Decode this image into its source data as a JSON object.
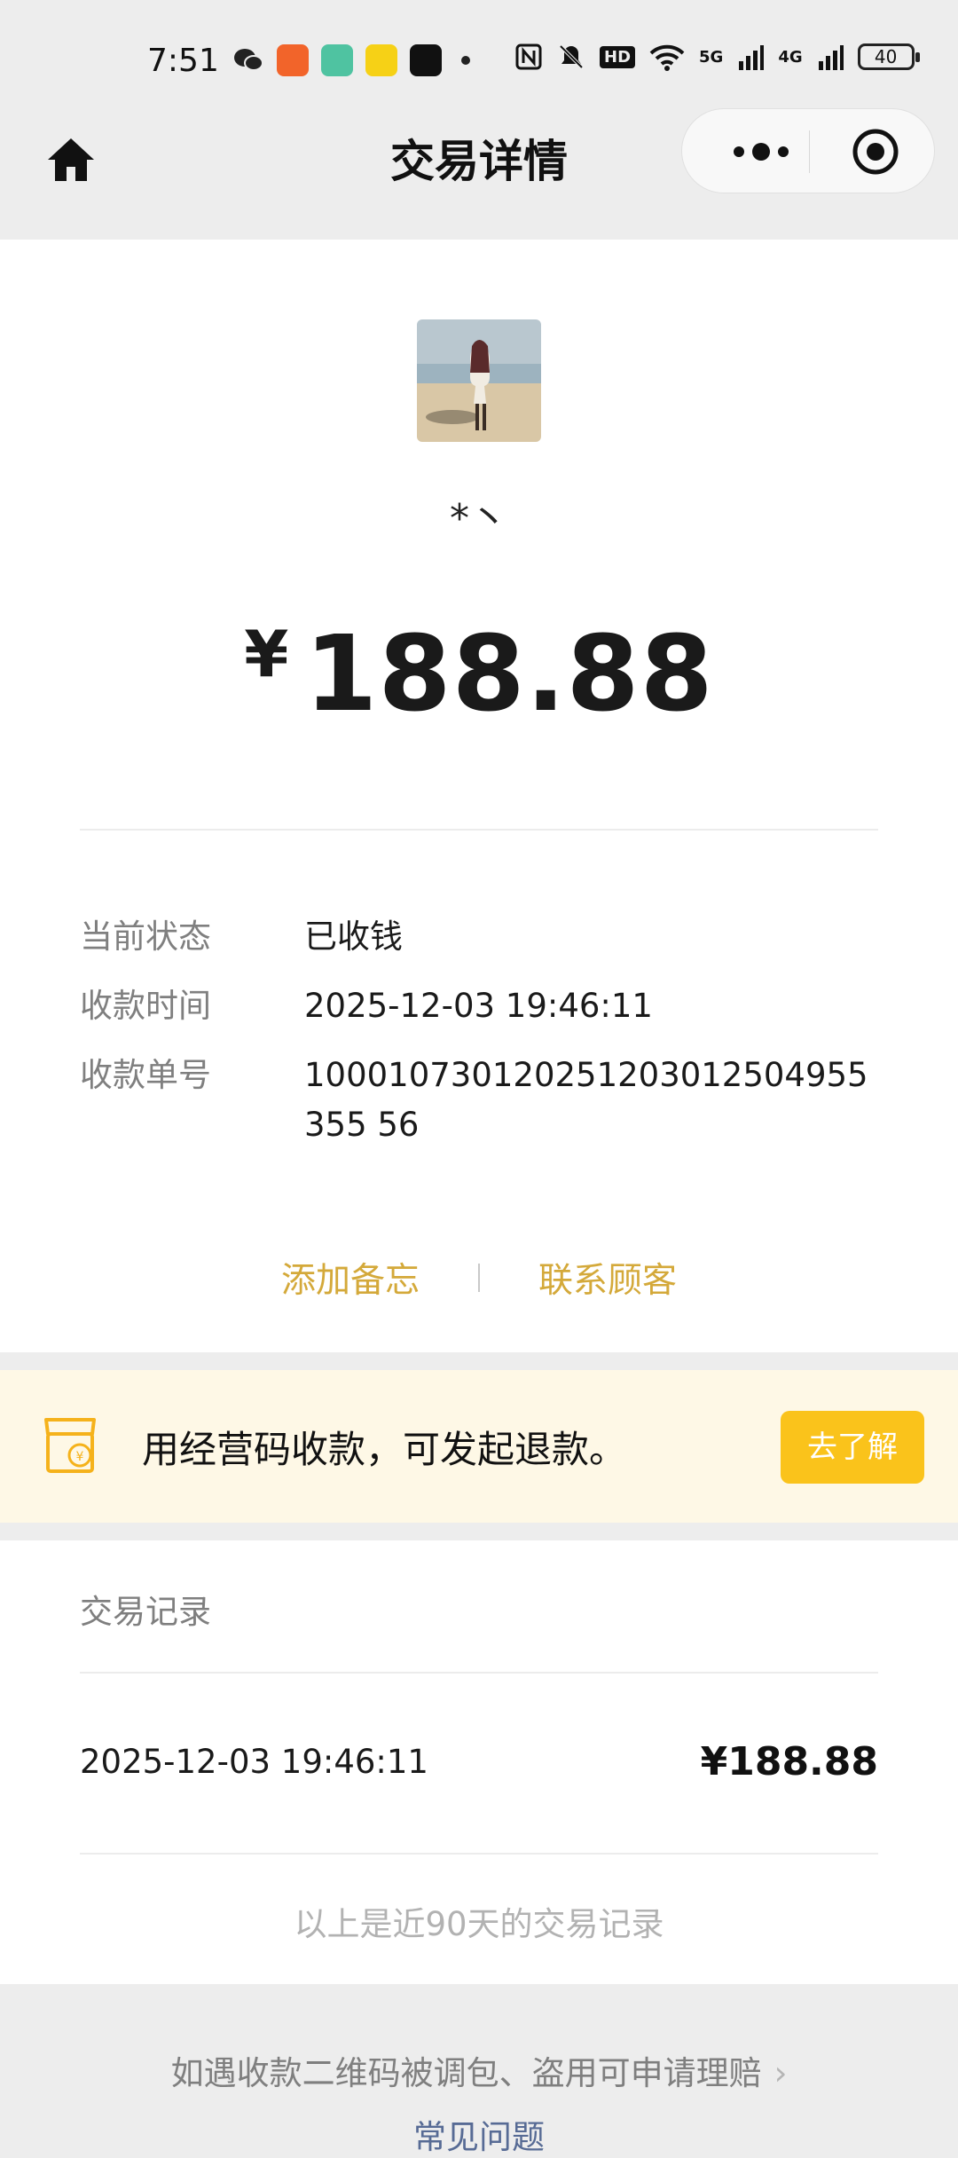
{
  "status_bar": {
    "time": "7:51",
    "battery": "40",
    "network_labels": [
      "HD",
      "5G",
      "4G"
    ]
  },
  "navbar": {
    "title": "交易详情"
  },
  "payer": {
    "nickname": "*丶"
  },
  "amount": {
    "currency": "¥",
    "value": "188.88"
  },
  "details": [
    {
      "label": "当前状态",
      "value": "已收钱"
    },
    {
      "label": "收款时间",
      "value": "2025-12-03 19:46:11"
    },
    {
      "label": "收款单号",
      "value": "100010730120251203012504955355 56"
    }
  ],
  "actions": {
    "add_note": "添加备忘",
    "contact_customer": "联系顾客"
  },
  "promo": {
    "text": "用经营码收款，可发起退款。",
    "button": "去了解",
    "accent": "#fac31b"
  },
  "records": {
    "title": "交易记录",
    "items": [
      {
        "time": "2025-12-03 19:46:11",
        "amount": "¥188.88"
      }
    ],
    "note": "以上是近90天的交易记录"
  },
  "footer": {
    "claim_link": "如遇收款二维码被调包、盗用可申请理赔",
    "faq": "常见问题"
  }
}
